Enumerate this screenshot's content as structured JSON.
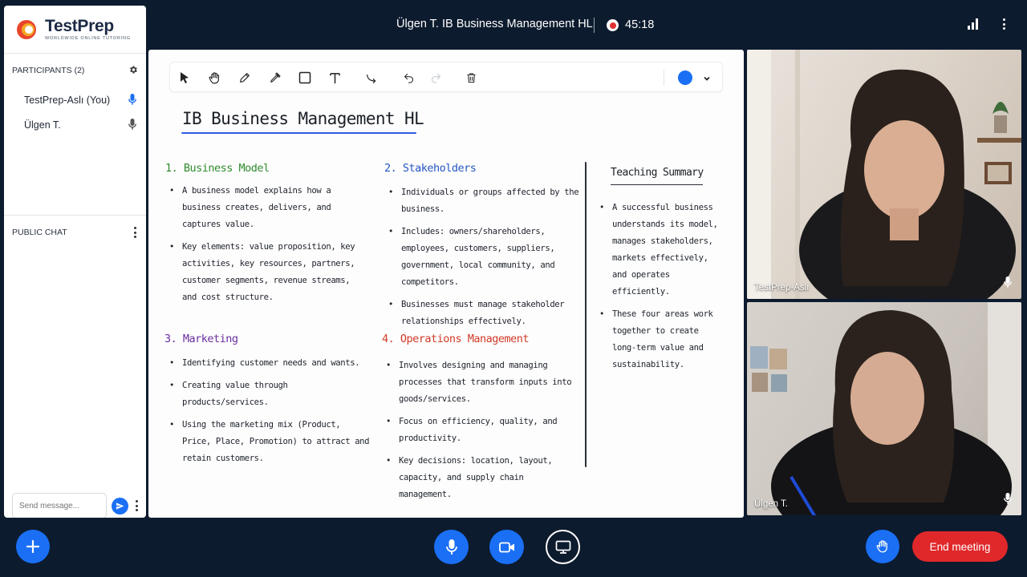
{
  "app": {
    "logo_name": "TestPrep",
    "logo_tagline": "WORLDWIDE ONLINE TUTORING"
  },
  "header": {
    "meeting_title": "Ülgen T. IB Business Management HL",
    "timer": "45:18"
  },
  "sidebar": {
    "participants_label": "PARTICIPANTS (2)",
    "participants": [
      {
        "name": "TestPrep-Aslı (You)",
        "mic_active": true
      },
      {
        "name": "Ülgen T.",
        "mic_active": false
      }
    ],
    "chat_label": "PUBLIC CHAT",
    "chat_placeholder": "Send message..."
  },
  "whiteboard": {
    "title": "IB Business Management HL",
    "sections": [
      {
        "title": "1.  Business Model",
        "color": "#2e8b2e",
        "bullets": [
          "A business model explains how a business creates, delivers, and captures value.",
          "Key elements: value proposition, key activities, key resources, partners, customer segments, revenue streams, and cost structure."
        ]
      },
      {
        "title": "2.  Stakeholders",
        "color": "#2457c5",
        "bullets": [
          "Individuals or groups affected by the business.",
          "Includes: owners/shareholders, employees, customers, suppliers, government, local community, and competitors.",
          "Businesses must manage stakeholder relationships effectively."
        ]
      },
      {
        "title": "3.  Marketing",
        "color": "#6a2ea0",
        "bullets": [
          "Identifying customer needs and wants.",
          "Creating value through products/services.",
          "Using the marketing mix (Product, Price, Place, Promotion) to attract and retain customers."
        ]
      },
      {
        "title": "4.  Operations Management",
        "color": "#d13a26",
        "bullets": [
          "Involves designing and managing processes that transform inputs into goods/services.",
          "Focus on efficiency, quality, and productivity.",
          "Key decisions: location, layout, capacity, and supply chain management."
        ]
      }
    ],
    "summary_title": "Teaching Summary",
    "summary_bullets": [
      "A successful business understands its model, manages stakeholders, markets effectively, and operates efficiently.",
      "These four areas work together to create long-term value and sustainability."
    ],
    "pen_color": "#1a6ff5"
  },
  "videos": [
    {
      "name": "TestPrep-Aslı"
    },
    {
      "name": "Ülgen T."
    }
  ],
  "controls": {
    "end_meeting_label": "End meeting"
  },
  "colors": {
    "accent": "#1a6ff5",
    "end_meeting": "#e0282a",
    "background": "#0d1b2e"
  }
}
